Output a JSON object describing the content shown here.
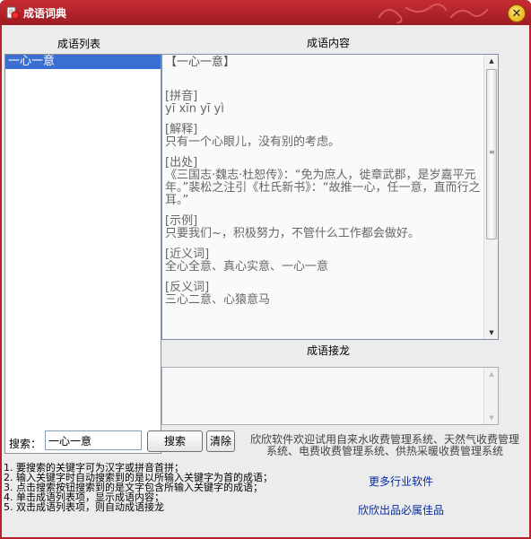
{
  "window": {
    "title": "成语词典"
  },
  "labels": {
    "list_header": "成语列表",
    "content_header": "成语内容",
    "chain_header": "成语接龙",
    "search_label": "搜索："
  },
  "idiom_list": {
    "items": [
      "一心一意"
    ],
    "selected_index": 0
  },
  "content": {
    "title": "【一心一意】",
    "pinyin_label": "[拼音]",
    "pinyin": "yī  xīn  yī  yì",
    "meaning_label": "[解释]",
    "meaning": "只有一个心眼儿，没有别的考虑。",
    "source_label": "[出处]",
    "source": "《三国志·魏志·杜恕传》：“免为庶人，徙章武郡，是岁嘉平元年。”裴松之注引《杜氏新书》：“故推一心，任一意，直而行之耳。”",
    "example_label": "[示例]",
    "example": "只要我们~，积极努力，不管什么工作都会做好。",
    "synonym_label": "[近义词]",
    "synonym": "全心全意、真心实意、一心一意",
    "antonym_label": "[反义词]",
    "antonym": "三心二意、心猿意马"
  },
  "search": {
    "value": "一心一意"
  },
  "buttons": {
    "search": "搜索",
    "clear": "清除"
  },
  "promo": {
    "line1": "欣欣软件欢迎试用自来水收费管理系统、天然气收费管理",
    "line2": "系统、电费收费管理系统、供热采暖收费管理系统"
  },
  "tips": [
    "1.  要搜索的关键字可为汉字或拼音首拼；",
    "2.  输入关键字时自动搜索到的是以所输入关键字为首的成语；",
    "3.  点击搜索按钮搜索到的是文字包含所输入关键字的成语；",
    "4.  单击成语列表项，显示成语内容；",
    "5.  双击成语列表项，则自动成语接龙"
  ],
  "links": {
    "more_software": "更多行业软件",
    "tagline": "欣欣出品必属佳品"
  },
  "colors": {
    "title_bar": "#b4232b",
    "selection": "#3a6fd1",
    "link": "#0a2aa0"
  },
  "icons": {
    "app": "app-icon",
    "close": "close-icon"
  }
}
